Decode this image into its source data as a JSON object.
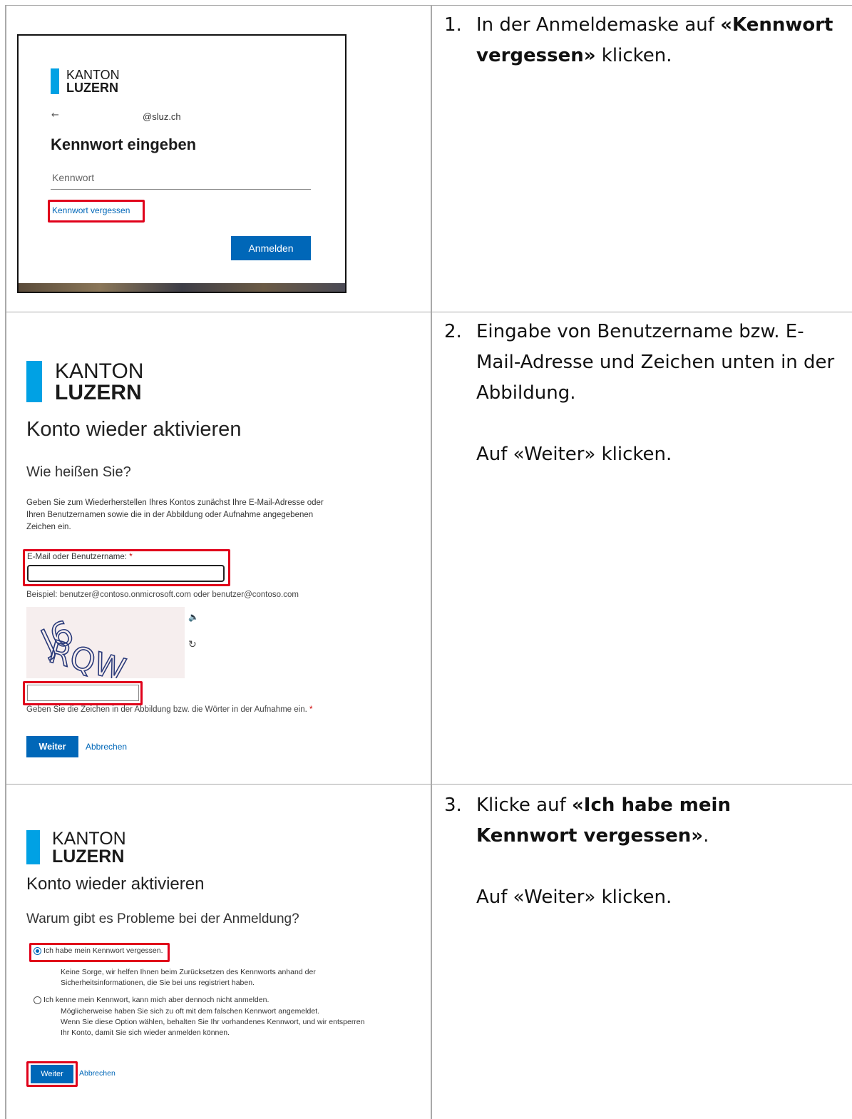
{
  "rows": [
    {
      "step_num": "1.",
      "step_text_pre": "In der Anmeldemaske auf ",
      "step_text_bold": "«Kennwort vergessen»",
      "step_text_post": " klicken.",
      "shot": {
        "logo_line1": "KANTON",
        "logo_line2": "LUZERN",
        "back_arrow": "←",
        "email_suffix": "@sluz.ch",
        "heading": "Kennwort eingeben",
        "password_placeholder": "Kennwort",
        "forgot_link": "Kennwort vergessen",
        "signin_button": "Anmelden"
      }
    },
    {
      "step_num": "2.",
      "step_text": "Eingabe von Benutzername bzw. E-Mail-Adresse und Zeichen unten in der Abbildung.",
      "step_text2": "Auf «Weiter» klicken.",
      "shot": {
        "logo_line1": "KANTON",
        "logo_line2": "LUZERN",
        "title": "Konto wieder aktivieren",
        "subtitle": "Wie heißen Sie?",
        "description": "Geben Sie zum Wiederherstellen Ihres Kontos zunächst Ihre E-Mail-Adresse oder Ihren Benutzernamen sowie die in der Abbildung oder Aufnahme angegebenen Zeichen ein.",
        "email_label": "E-Mail oder Benutzername:",
        "required_mark": "*",
        "example": "Beispiel: benutzer@contoso.onmicrosoft.com oder benutzer@contoso.com",
        "captcha_text": "J6RQW",
        "captcha_hint": "Geben Sie die Zeichen in der Abbildung bzw. die Wörter in der Aufnahme ein.",
        "next_button": "Weiter",
        "cancel_link": "Abbrechen"
      }
    },
    {
      "step_num": "3.",
      "step_text_pre": "Klicke auf ",
      "step_text_bold": "«Ich habe mein Kennwort vergessen»",
      "step_text_post": ".",
      "step_text2": "Auf «Weiter» klicken.",
      "shot": {
        "logo_line1": "KANTON",
        "logo_line2": "LUZERN",
        "title": "Konto wieder aktivieren",
        "subtitle": "Warum gibt es Probleme bei der Anmeldung?",
        "option1_label": "Ich habe mein Kennwort vergessen.",
        "option1_desc_1": "Keine Sorge, wir helfen Ihnen beim Zurücksetzen des Kennworts anhand der",
        "option1_desc_2": "Sicherheitsinformationen, die Sie bei uns registriert haben.",
        "option2_label": "Ich kenne mein Kennwort, kann mich aber dennoch nicht anmelden.",
        "option2_desc_1": "Möglicherweise haben Sie sich zu oft mit dem falschen Kennwort angemeldet.",
        "option2_desc_2": "Wenn Sie diese Option wählen, behalten Sie Ihr vorhandenes Kennwort, und wir entsperren",
        "option2_desc_3": "Ihr Konto, damit Sie sich wieder anmelden können.",
        "next_button": "Weiter",
        "cancel_link": "Abbrechen"
      }
    }
  ],
  "colors": {
    "brand_blue": "#00a1e4",
    "button_blue": "#0067b8",
    "highlight_red": "#e0001a",
    "table_border": "#a9a9a9"
  }
}
